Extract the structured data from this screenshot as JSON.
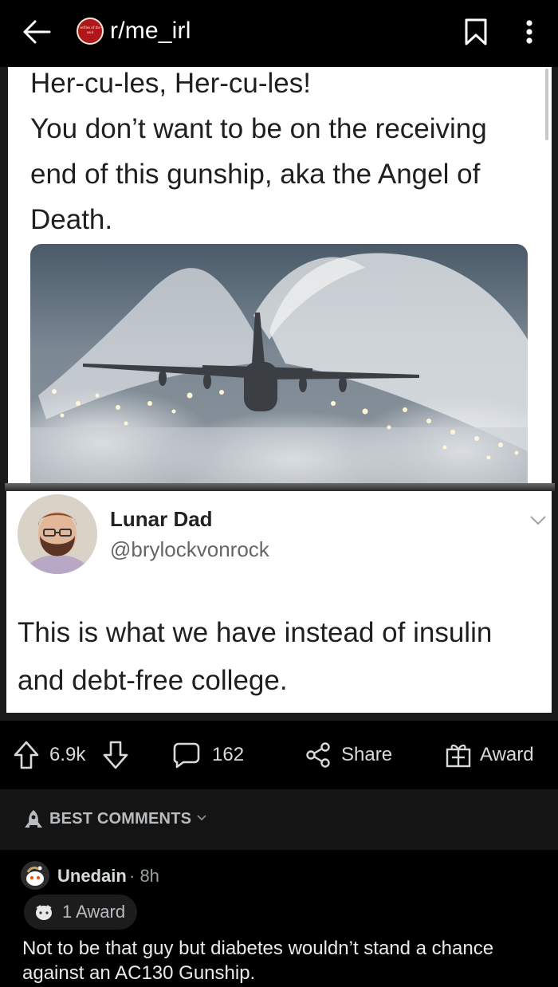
{
  "header": {
    "subreddit": "r/me_irl",
    "subreddit_icon_text": "selfies of the soul"
  },
  "post_image": {
    "tweet1": {
      "lines": [
        "Her-cu-les, Her-cu-les!",
        "You don’t want to be on the receiving",
        "end of this gunship, aka the Angel of",
        "Death."
      ]
    },
    "tweet2": {
      "name": "Lunar Dad",
      "handle": "@brylockvonrock",
      "lines": [
        "This is what we have instead of insulin",
        "and debt-free college."
      ]
    }
  },
  "actions": {
    "score": "6.9k",
    "comments": "162",
    "share": "Share",
    "award": "Award"
  },
  "sort": {
    "label": "BEST COMMENTS"
  },
  "comment": {
    "author": "Unedain",
    "meta": "· 8h",
    "award": "1 Award",
    "lines": [
      "Not to be that guy but diabetes wouldn’t stand a chance",
      "against an AC130 Gunship."
    ]
  },
  "colors": {
    "background": "#000000",
    "tweet_background": "#ffffff",
    "sort_bar": "#141415",
    "text_primary": "#d7dadc",
    "subreddit_icon": "#b0171b"
  },
  "icons": {
    "back": "arrow-left",
    "bookmark": "bookmark",
    "more": "three-dots-vertical",
    "upvote": "arrow-up",
    "downvote": "arrow-down",
    "comments": "speech-bubble",
    "share": "share-nodes",
    "award": "gift-box",
    "sort": "rocket"
  }
}
